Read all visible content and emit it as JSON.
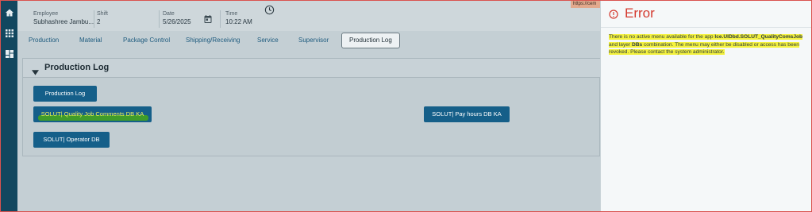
{
  "header": {
    "employee_label": "Employee",
    "employee_value": "Subhashree Jambu...",
    "shift_label": "Shift",
    "shift_value": "2",
    "date_label": "Date",
    "date_value": "5/26/2025",
    "time_label": "Time",
    "time_value": "10:22 AM",
    "url_text": "https://cem"
  },
  "tabs": [
    {
      "label": "Production"
    },
    {
      "label": "Material"
    },
    {
      "label": "Package Control"
    },
    {
      "label": "Shipping/Receiving"
    },
    {
      "label": "Service"
    },
    {
      "label": "Supervisor"
    },
    {
      "label": "Production Log"
    }
  ],
  "active_tab": "Production Log",
  "panel": {
    "title": "Production Log",
    "buttons": [
      {
        "label": "Production Log"
      },
      {
        "label": "SOLUT| Quality Job Comments DB KA"
      },
      {
        "label": "SOLUT| Operator DB"
      },
      {
        "label": "SOLUT| Pay hours DB KA"
      }
    ]
  },
  "error": {
    "title": "Error",
    "message_parts": [
      "There is no active menu available for the app ",
      "Ice.UIDbd.SOLUT_QualityComsJob",
      " and layer ",
      "DBs",
      " combination. The menu may either be disabled or access has been revoked. Please contact the system administrator."
    ]
  },
  "colors": {
    "rail": "#12475f",
    "button": "#155f89",
    "error_red": "#d43a2f",
    "highlight_yellow": "#f4f23e",
    "highlight_green": "#3f9c2a"
  },
  "icons": {
    "rail": [
      "home-icon",
      "apps-grid-icon",
      "dashboard-icon"
    ],
    "header": [
      "calendar-icon",
      "clock-icon"
    ],
    "panel": [
      "chevron-down-icon"
    ],
    "error": [
      "error-circle-icon"
    ]
  }
}
